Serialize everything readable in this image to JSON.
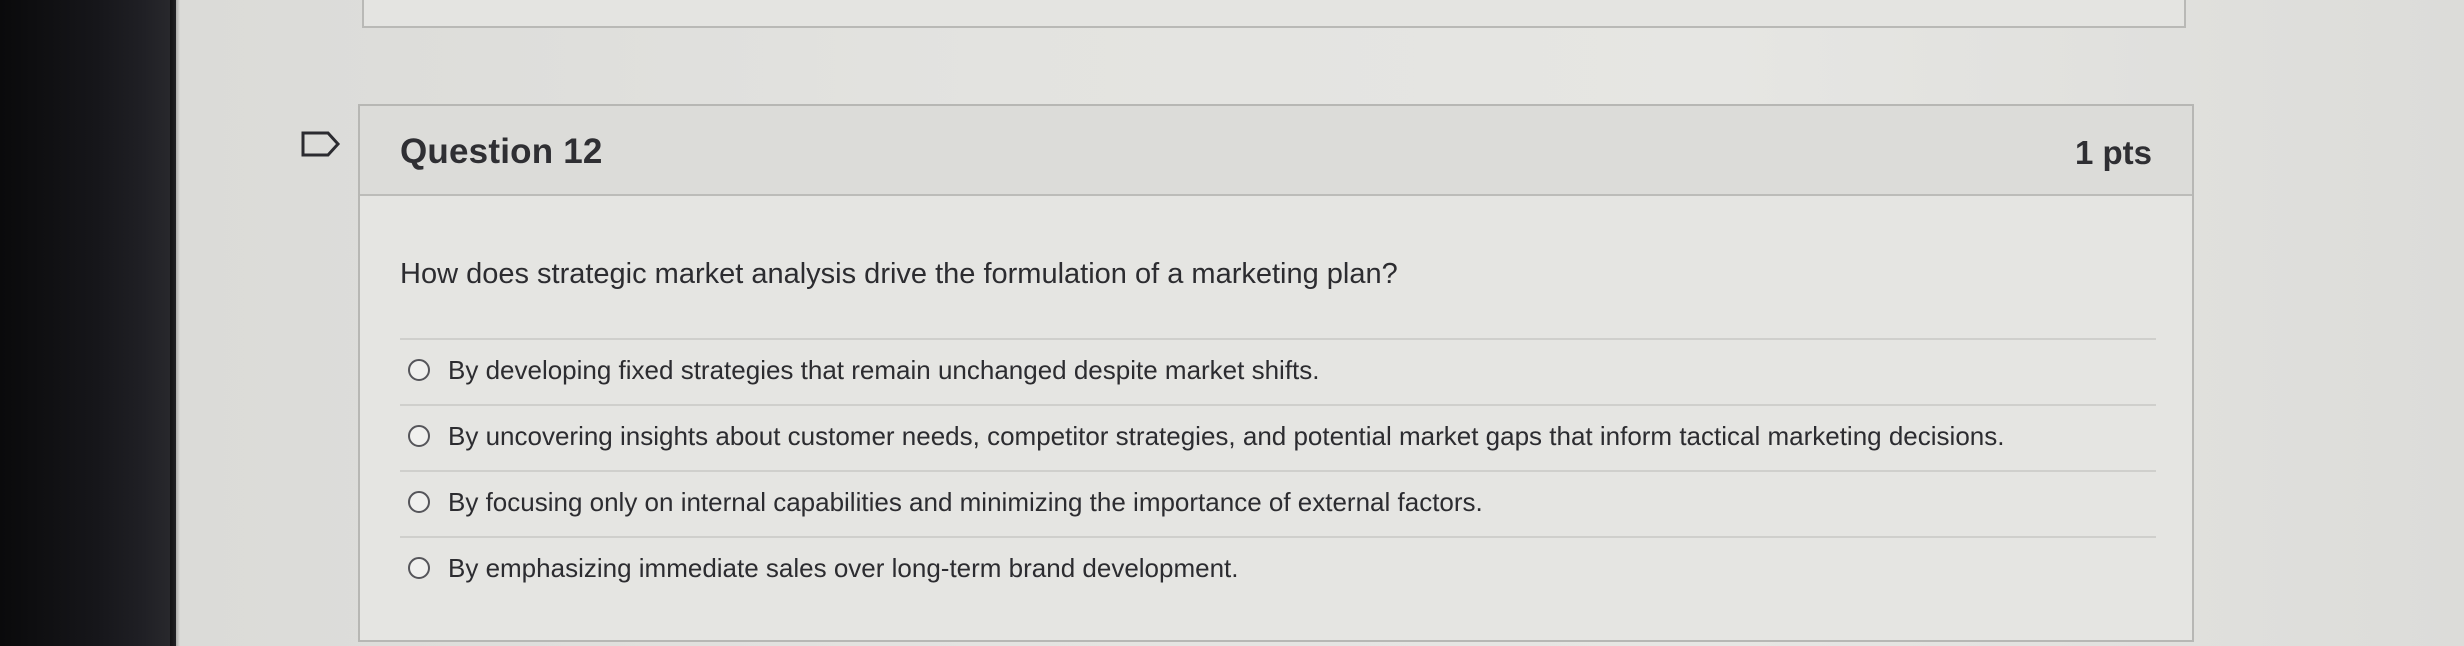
{
  "question": {
    "title": "Question 12",
    "points": "1 pts",
    "text": "How does strategic market analysis drive the formulation of a marketing plan?",
    "flag_icon": "flag-outline-icon",
    "answers": [
      {
        "label": "By developing fixed strategies that remain unchanged despite market shifts."
      },
      {
        "label": "By uncovering insights about customer needs, competitor strategies, and potential market gaps that inform tactical marketing decisions."
      },
      {
        "label": "By focusing only on internal capabilities and minimizing the importance of external factors."
      },
      {
        "label": "By emphasizing immediate sales over long-term brand development."
      }
    ]
  }
}
